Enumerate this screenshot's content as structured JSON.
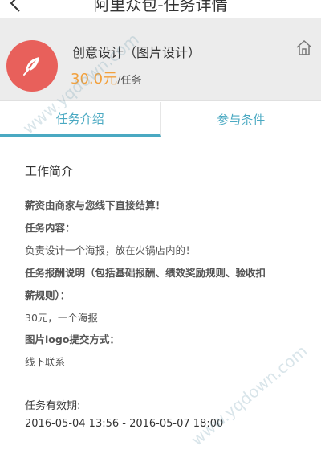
{
  "header": {
    "title": "阿里众包-任务详情"
  },
  "task": {
    "title": "创意设计（图片设计）",
    "price": "30.0元",
    "unit": "/任务"
  },
  "tabs": [
    {
      "label": "任务介绍",
      "active": true
    },
    {
      "label": "参与条件",
      "active": false
    }
  ],
  "content": {
    "section_title": "工作简介",
    "lines": [
      {
        "text": "薪资由商家与您线下直接结算！",
        "style": "bold"
      },
      {
        "text": "任务内容：",
        "style": "bold"
      },
      {
        "text": "负责设计一个海报，放在火锅店内的！",
        "style": "normal"
      },
      {
        "text": "任务报酬说明（包括基础报酬、绩效奖励规则、验收扣",
        "style": "bold"
      },
      {
        "text": "薪规则）：",
        "style": "bold"
      },
      {
        "text": "30元，一个海报",
        "style": "normal"
      },
      {
        "text": "图片logo提交方式：",
        "style": "bold"
      },
      {
        "text": "线下联系",
        "style": "normal"
      }
    ],
    "expiry_label": "任务有效期:",
    "expiry_value": "2016-05-04 13:56 - 2016-05-07 18:00"
  },
  "watermarks": [
    "www.yqdown.com",
    "www.yqdown.com"
  ],
  "colors": {
    "accent": "#4aa9c2",
    "price": "#f2a03c",
    "avatar": "#e8605b"
  },
  "icons": [
    "back-arrow-icon",
    "feather-icon",
    "home-icon"
  ]
}
